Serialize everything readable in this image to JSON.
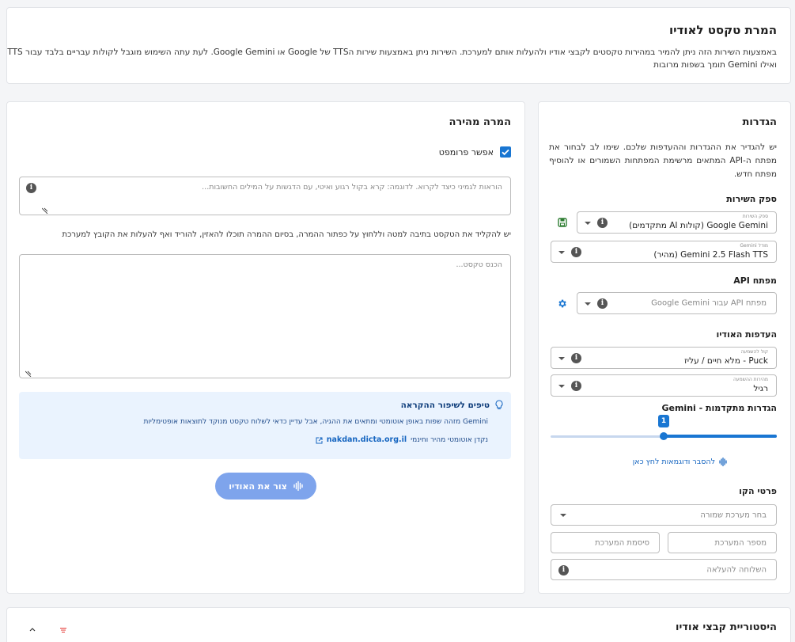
{
  "header": {
    "title": "המרת טקסט לאודיו",
    "description_line1": "באמצעות השירות הזה ניתן להמיר במהירות טקסטים לקבצי אודיו ולהעלות אותם למערכת. השירות ניתן באמצעות שירות הTTS של Google או Google Gemini. לעת עתה השימוש מוגבל לקולות עבריים בלבד עבור Google TTS,",
    "description_line2": "ואילו Gemini תומך בשפות מרובות"
  },
  "settings": {
    "title": "הגדרות",
    "intro": "יש להגדיר את ההגדרות וההעדפות שלכם. שימו לב לבחור את מפתח ה-API המתאים מרשימת המפתחות השמורים או להוסיף מפתח חדש.",
    "provider_section": "ספק השירות",
    "provider_label": "ספק השירות",
    "provider_value": "Google Gemini (קולות AI מתקדמים)",
    "model_label": "מודל Gemini",
    "model_value": "Gemini 2.5 Flash TTS (מהיר)",
    "api_section": "מפתח API",
    "api_placeholder": "מפתח API עבור Google Gemini",
    "audio_section": "העדפות האודיו",
    "voice_label": "קול להשמעה",
    "voice_value": "Puck - מלא חיים / עליז",
    "speed_label": "מהירות ההשמעה",
    "speed_value": "רגיל",
    "advanced_section": "הגדרות מתקדמות - Gemini",
    "slider_value": "1",
    "examples_link": "להסבר ודוגמאות לחץ כאן",
    "line_section": "פרטי הקו",
    "saved_system_placeholder": "בחר מערכת שמורה",
    "system_number_placeholder": "מספר המערכת",
    "system_password_placeholder": "סיסמת המערכת",
    "extension_placeholder": "השלוחה להעלאה"
  },
  "quick": {
    "title": "המרה מהירה",
    "enable_prompt_label": "אפשר פרומפט",
    "prompt_placeholder": "הוראות לגמיני כיצד לקרוא. לדוגמה: קרא בקול רגוע ואיטי, עם הדגשות על המילים החשובות...",
    "instructions": "יש להקליד את הטקסט בתיבה למטה וללחוץ על כפתור ההמרה, בסיום ההמרה תוכלו להאזין, להוריד ואף להעלות את הקובץ למערכת",
    "text_placeholder": "הכנס טקסט...",
    "tips_title": "טיפים לשיפור ההקראה",
    "tips_body": "Gemini מזהה שפות באופן אוטומטי ומתאים את ההגיה, אבל עדיין כדאי לשלוח טקסט מנוקד לתוצאות אופטימליות",
    "tips_link_text": "nakdan.dicta.org.il",
    "tips_link_desc": "נקדן אוטומטי מהיר וחינמי",
    "generate_button": "צור את האודיו"
  },
  "history": {
    "title": "היסטוריית קבצי אודיו"
  },
  "colors": {
    "accent": "#1976d2",
    "button": "#7ea4ec",
    "save_icon": "#2e7d32",
    "tip_bg": "#eaf3fe"
  }
}
